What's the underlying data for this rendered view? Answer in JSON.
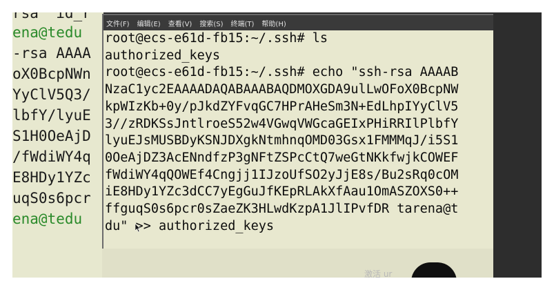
{
  "menu": [
    "文件(F)",
    "编辑(E)",
    "查看(V)",
    "搜索(S)",
    "终端(T)",
    "帮助(H)"
  ],
  "background_terminal": {
    "lines": [
      {
        "text": "rsa  id_r",
        "green": false
      },
      {
        "text": "ena@tedu",
        "green": true
      },
      {
        "text": "-rsa AAAA",
        "green": false
      },
      {
        "text": "oX0BcpNWn",
        "green": false
      },
      {
        "text": "YyClV5Q3/",
        "green": false
      },
      {
        "text": "lbfY/lyuE",
        "green": false
      },
      {
        "text": "S1H0OeAjD",
        "green": false
      },
      {
        "text": "/fWdiWY4q",
        "green": false
      },
      {
        "text": "E8HDy1YZc",
        "green": false
      },
      {
        "text": "uqS0s6pcr",
        "green": false
      },
      {
        "text": "ena@tedu",
        "green": true
      }
    ]
  },
  "terminal": {
    "lines": [
      "root@ecs-e61d-fb15:~/.ssh# ls",
      "authorized_keys",
      "root@ecs-e61d-fb15:~/.ssh# echo \"ssh-rsa AAAAB",
      "NzaC1yc2EAAAADAQABAAABAQDMOXGDA9ulLwOFoX0BcpNW",
      "kpWIzKb+0y/pJkdZYFvqGC7HPrAHeSm3N+EdLhpIYyClV5",
      "3//zRDKSsJntlroeS52w4VGwqVWGcaGEIxPHiRRIlPlbfY",
      "lyuEJsMUSBDyKSNJDXgkNtmhnqOMD03Gsx1FMMMqJ/i5S1",
      "0OeAjDZ3AcENndfzP3gNFtZSPcCtQ7weGtNKkfwjkCOWEF",
      "fWdiWY4qQOWEf4Cngjj1IJzoUfSO2yJjE8s/Bu2sRq0cOM",
      "iE8HDy1YZc3dCC7yEgGuJfKEpRLAkXfAau1OmASZOXS0++",
      "ffguqS0s6pcr0sZaeZK3HLwdKzpA1JlIPvfDR tarena@t",
      "du\" >> authorized_keys"
    ]
  },
  "watermark": "激活 ur"
}
